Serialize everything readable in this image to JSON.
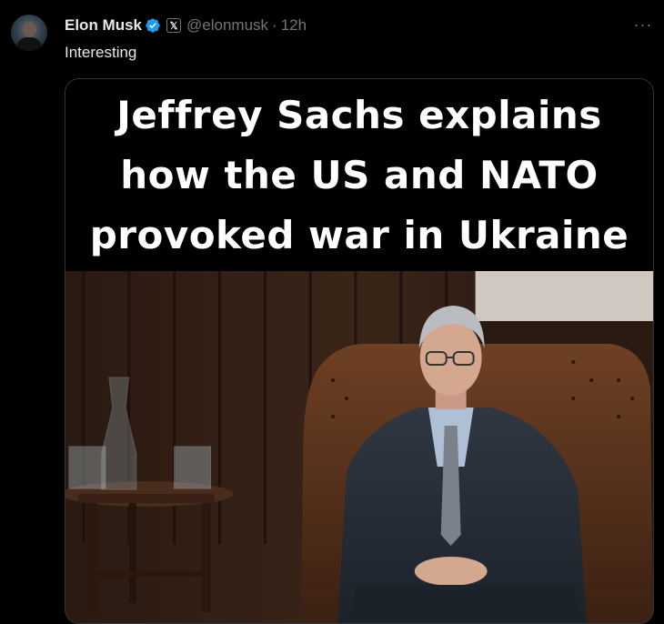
{
  "author": {
    "name": "Elon Musk",
    "handle": "@elonmusk",
    "separator": "·",
    "time": "12h",
    "badge_letter": "𝕏"
  },
  "tweet": {
    "text": "Interesting"
  },
  "media": {
    "banner_lines": [
      "Jeffrey Sachs explains",
      "how the US and NATO",
      "provoked war in Ukraine"
    ]
  },
  "more_label": "···",
  "colors": {
    "background": "#000000",
    "text_primary": "#e7e9ea",
    "text_secondary": "#71767b",
    "verified_blue": "#1d9bf0",
    "media_border": "#333639"
  }
}
